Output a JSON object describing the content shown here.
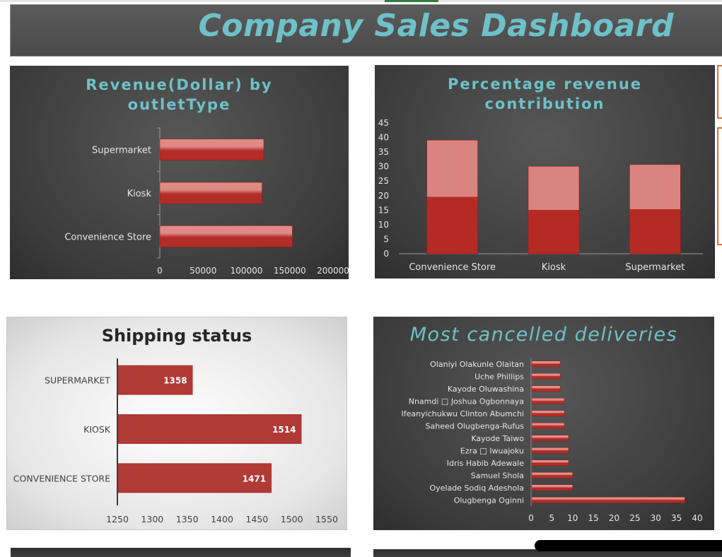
{
  "dashboard": {
    "title": "Company Sales Dashboard"
  },
  "charts": [
    {
      "id": "revenue",
      "title": "Revenue(Dollar) by outletType",
      "title_lines": [
        "Revenue(Dollar) by",
        "outletType"
      ],
      "chart_data": {
        "type": "bar",
        "orientation": "horizontal",
        "title": "Revenue(Dollar) by outletType",
        "categories": [
          "Convenience Store",
          "Kiosk",
          "Supermarket"
        ],
        "values": [
          153000,
          118000,
          120000
        ],
        "xlim": [
          0,
          200000
        ],
        "xticks": [
          0,
          50000,
          100000,
          150000,
          200000
        ],
        "tick_labels": [
          "0",
          "50000",
          "100000",
          "150000",
          "200000"
        ],
        "grid": false,
        "legend": "none",
        "color": "#c0302b"
      }
    },
    {
      "id": "percentage",
      "title": "Percentage revenue contribution",
      "title_lines": [
        "Percentage revenue",
        "contribution"
      ],
      "chart_data": {
        "type": "bar",
        "title": "Percentage revenue contribution",
        "categories": [
          "Convenience Store",
          "Kiosk",
          "Supermarket"
        ],
        "values": [
          39.1,
          30.1,
          30.7
        ],
        "ylim": [
          0,
          45
        ],
        "yticks": [
          0,
          5,
          10,
          15,
          20,
          25,
          30,
          35,
          40,
          45
        ],
        "tick_labels": [
          "0",
          "5",
          "10",
          "15",
          "20",
          "25",
          "30",
          "35",
          "40",
          "45"
        ],
        "grid": false,
        "legend": "none",
        "color": "#c0302b"
      }
    },
    {
      "id": "shipping",
      "title": "Shipping status",
      "chart_data": {
        "type": "bar",
        "orientation": "horizontal",
        "title": "Shipping status",
        "categories": [
          "CONVENIENCE STORE",
          "KIOSK",
          "SUPERMARKET"
        ],
        "values": [
          1471,
          1514,
          1358
        ],
        "data_labels": [
          "1471",
          "1514",
          "1358"
        ],
        "xlim": [
          1250,
          1550
        ],
        "xticks": [
          1250,
          1300,
          1350,
          1400,
          1450,
          1500,
          1550
        ],
        "tick_labels": [
          "1250",
          "1300",
          "1350",
          "1400",
          "1450",
          "1500",
          "1550"
        ],
        "grid": false,
        "legend": "none",
        "color": "#b03a36"
      }
    },
    {
      "id": "cancelled",
      "title": "Most cancelled deliveries",
      "chart_data": {
        "type": "bar",
        "orientation": "horizontal",
        "title": "Most cancelled deliveries",
        "categories": [
          "Olugbenga Oginni",
          "Oyelade Sodiq  Adeshola",
          "Samuel Shola",
          "Idris Habib Adewale",
          "Ezra □ Iwuajoku",
          "Kayode  Taiwo",
          "Saheed  Olugbenga-Rufus",
          "Ifeanyichukwu  Clinton Abumchi",
          "Nnamdi □ Joshua Ogbonnaya",
          "Kayode  Oluwashina",
          "Uche Phillips",
          "Olaniyi Olakunle  Olaitan"
        ],
        "values": [
          37,
          10,
          10,
          9,
          9,
          9,
          8,
          8,
          8,
          7,
          7,
          7
        ],
        "xlim": [
          0,
          40
        ],
        "xticks": [
          0,
          5,
          10,
          15,
          20,
          25,
          30,
          35,
          40
        ],
        "tick_labels": [
          "0",
          "5",
          "10",
          "15",
          "20",
          "25",
          "30",
          "35",
          "40"
        ],
        "grid": false,
        "legend": "none",
        "color": "#c0302b"
      }
    }
  ]
}
